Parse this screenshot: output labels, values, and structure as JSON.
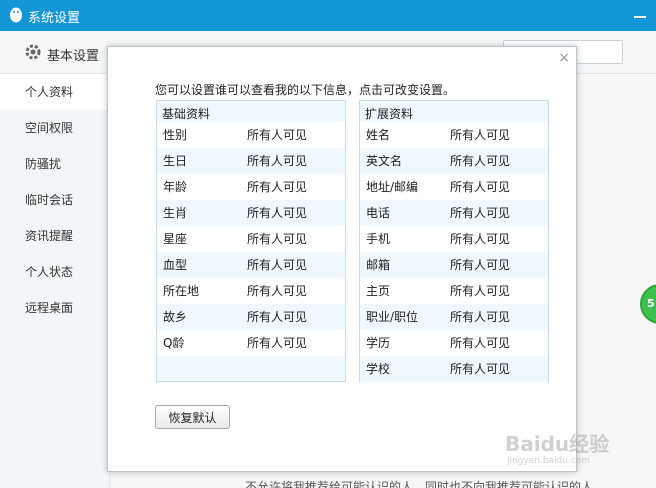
{
  "window": {
    "title": "系统设置"
  },
  "toolbar": {
    "tab_basic": "基本设置"
  },
  "sidebar": {
    "items": [
      {
        "label": "个人资料"
      },
      {
        "label": "空间权限"
      },
      {
        "label": "防骚扰"
      },
      {
        "label": "临时会话"
      },
      {
        "label": "资讯提醒"
      },
      {
        "label": "个人状态"
      },
      {
        "label": "远程桌面"
      }
    ]
  },
  "background": {
    "float_badge": "5",
    "bottom_text": "不允许将我推荐给可能认识的人，同时也不向我推荐可能认识的人"
  },
  "modal": {
    "close_label": "×",
    "instruction": "您可以设置谁可以查看我的以下信息，点击可改变设置。",
    "basic": {
      "title": "基础资料",
      "rows": [
        {
          "label": "性别",
          "value": "所有人可见"
        },
        {
          "label": "生日",
          "value": "所有人可见"
        },
        {
          "label": "年龄",
          "value": "所有人可见"
        },
        {
          "label": "生肖",
          "value": "所有人可见"
        },
        {
          "label": "星座",
          "value": "所有人可见"
        },
        {
          "label": "血型",
          "value": "所有人可见"
        },
        {
          "label": "所在地",
          "value": "所有人可见"
        },
        {
          "label": "故乡",
          "value": "所有人可见"
        },
        {
          "label": "Q龄",
          "value": "所有人可见"
        }
      ]
    },
    "extended": {
      "title": "扩展资料",
      "rows": [
        {
          "label": "姓名",
          "value": "所有人可见"
        },
        {
          "label": "英文名",
          "value": "所有人可见"
        },
        {
          "label": "地址/邮编",
          "value": "所有人可见"
        },
        {
          "label": "电话",
          "value": "所有人可见"
        },
        {
          "label": "手机",
          "value": "所有人可见"
        },
        {
          "label": "邮箱",
          "value": "所有人可见"
        },
        {
          "label": "主页",
          "value": "所有人可见"
        },
        {
          "label": "职业/职位",
          "value": "所有人可见"
        },
        {
          "label": "学历",
          "value": "所有人可见"
        },
        {
          "label": "学校",
          "value": "所有人可见"
        }
      ]
    },
    "restore_label": "恢复默认"
  },
  "watermark": {
    "brand": "Baidu经验",
    "sub": "jingyan.baidu.com"
  },
  "colors": {
    "titlebar": "#1296d8",
    "panel_bg": "#eef8fd",
    "panel_border": "#c7dce9",
    "badge": "#3cc24c"
  },
  "icons": {
    "logo": "penguin-icon",
    "settings": "gear-icon",
    "close": "close-icon",
    "minimize": "minimize-icon"
  }
}
